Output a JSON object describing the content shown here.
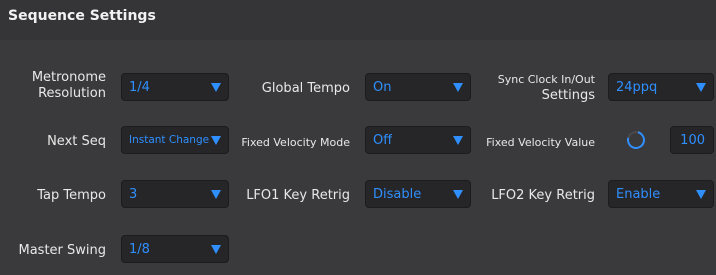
{
  "panel": {
    "title": "Sequence Settings"
  },
  "colors": {
    "background": "#3a3a3c",
    "accent": "#2f8fff",
    "control_background": "#262628"
  },
  "settings": {
    "metronome_resolution": {
      "label_line1": "Metronome",
      "label_line2": "Resolution",
      "value": "1/4"
    },
    "global_tempo": {
      "label": "Global Tempo",
      "value": "On"
    },
    "sync_clock": {
      "label_line1": "Sync Clock In/Out",
      "label_line2": "Settings",
      "value": "24ppq"
    },
    "next_seq": {
      "label": "Next Seq",
      "value": "Instant Change"
    },
    "fixed_velocity_mode": {
      "label": "Fixed Velocity Mode",
      "value": "Off"
    },
    "fixed_velocity_value": {
      "label": "Fixed Velocity Value",
      "value": "100"
    },
    "tap_tempo": {
      "label": "Tap Tempo",
      "value": "3"
    },
    "lfo1_key_retrig": {
      "label": "LFO1 Key Retrig",
      "value": "Disable"
    },
    "lfo2_key_retrig": {
      "label": "LFO2 Key Retrig",
      "value": "Enable"
    },
    "master_swing": {
      "label": "Master Swing",
      "value": "1/8"
    }
  },
  "icons": {
    "dropdown": "chevron-down-icon",
    "knob": "knob-icon"
  }
}
